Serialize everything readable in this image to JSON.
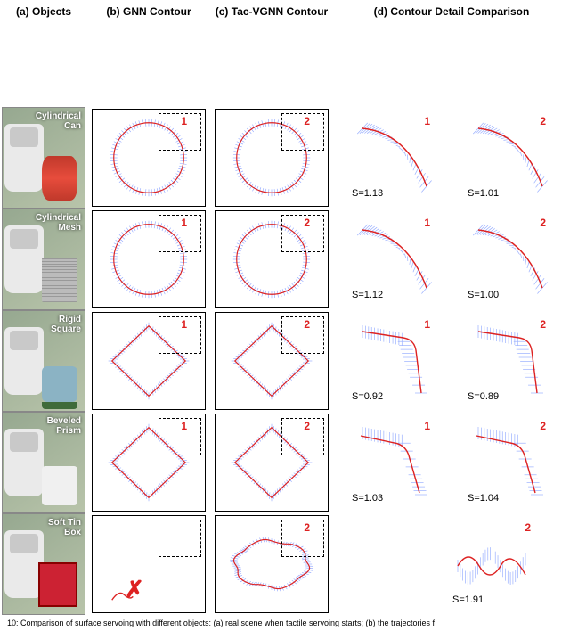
{
  "headers": {
    "a": "(a) Objects",
    "b": "(b) GNN Contour",
    "c": "(c) Tac-VGNN Contour",
    "d": "(d) Contour Detail Comparison"
  },
  "objects": [
    {
      "label": "Cylindrical\nCan",
      "objClass": "can"
    },
    {
      "label": "Cylindrical\nMesh",
      "objClass": "mesh"
    },
    {
      "label": "Rigid\nSquare",
      "objClass": "square"
    },
    {
      "label": "Beveled\nPrism",
      "objClass": "prism"
    },
    {
      "label": "Soft Tin\nBox",
      "objClass": "tin"
    }
  ],
  "contours": {
    "gnn": [
      "circle",
      "circle",
      "diamond",
      "diamond",
      "fail"
    ],
    "tac": [
      "circle",
      "circle",
      "diamond",
      "diamond",
      "rect"
    ]
  },
  "roi": {
    "gnn": "1",
    "tac": "2"
  },
  "details": [
    {
      "left": {
        "n": "1",
        "s": "S=1.13",
        "shape": "arc"
      },
      "right": {
        "n": "2",
        "s": "S=1.01",
        "shape": "arc"
      }
    },
    {
      "left": {
        "n": "1",
        "s": "S=1.12",
        "shape": "arc"
      },
      "right": {
        "n": "2",
        "s": "S=1.00",
        "shape": "arc"
      }
    },
    {
      "left": {
        "n": "1",
        "s": "S=0.92",
        "shape": "corner"
      },
      "right": {
        "n": "2",
        "s": "S=0.89",
        "shape": "corner"
      }
    },
    {
      "left": {
        "n": "1",
        "s": "S=1.03",
        "shape": "bevel"
      },
      "right": {
        "n": "2",
        "s": "S=1.04",
        "shape": "bevel"
      }
    },
    {
      "single": {
        "n": "2",
        "s": "S=1.91",
        "shape": "wave"
      }
    }
  ],
  "caption": "10: Comparison of surface servoing with different objects: (a) real scene when tactile servoing starts; (b) the trajectories f",
  "chart_data": [
    {
      "type": "line",
      "object": "Cylindrical Can",
      "series": [
        {
          "name": "GNN",
          "shape": "circle",
          "roi": 1,
          "smoothness": 1.13
        },
        {
          "name": "Tac-VGNN",
          "shape": "circle",
          "roi": 2,
          "smoothness": 1.01
        }
      ]
    },
    {
      "type": "line",
      "object": "Cylindrical Mesh",
      "series": [
        {
          "name": "GNN",
          "shape": "circle",
          "roi": 1,
          "smoothness": 1.12
        },
        {
          "name": "Tac-VGNN",
          "shape": "circle",
          "roi": 2,
          "smoothness": 1.0
        }
      ]
    },
    {
      "type": "line",
      "object": "Rigid Square",
      "series": [
        {
          "name": "GNN",
          "shape": "diamond",
          "roi": 1,
          "smoothness": 0.92
        },
        {
          "name": "Tac-VGNN",
          "shape": "diamond",
          "roi": 2,
          "smoothness": 0.89
        }
      ]
    },
    {
      "type": "line",
      "object": "Beveled Prism",
      "series": [
        {
          "name": "GNN",
          "shape": "diamond",
          "roi": 1,
          "smoothness": 1.03
        },
        {
          "name": "Tac-VGNN",
          "shape": "diamond",
          "roi": 2,
          "smoothness": 1.04
        }
      ]
    },
    {
      "type": "line",
      "object": "Soft Tin Box",
      "series": [
        {
          "name": "GNN",
          "shape": "fail"
        },
        {
          "name": "Tac-VGNN",
          "shape": "rounded-rect",
          "roi": 2,
          "smoothness": 1.91
        }
      ]
    }
  ]
}
